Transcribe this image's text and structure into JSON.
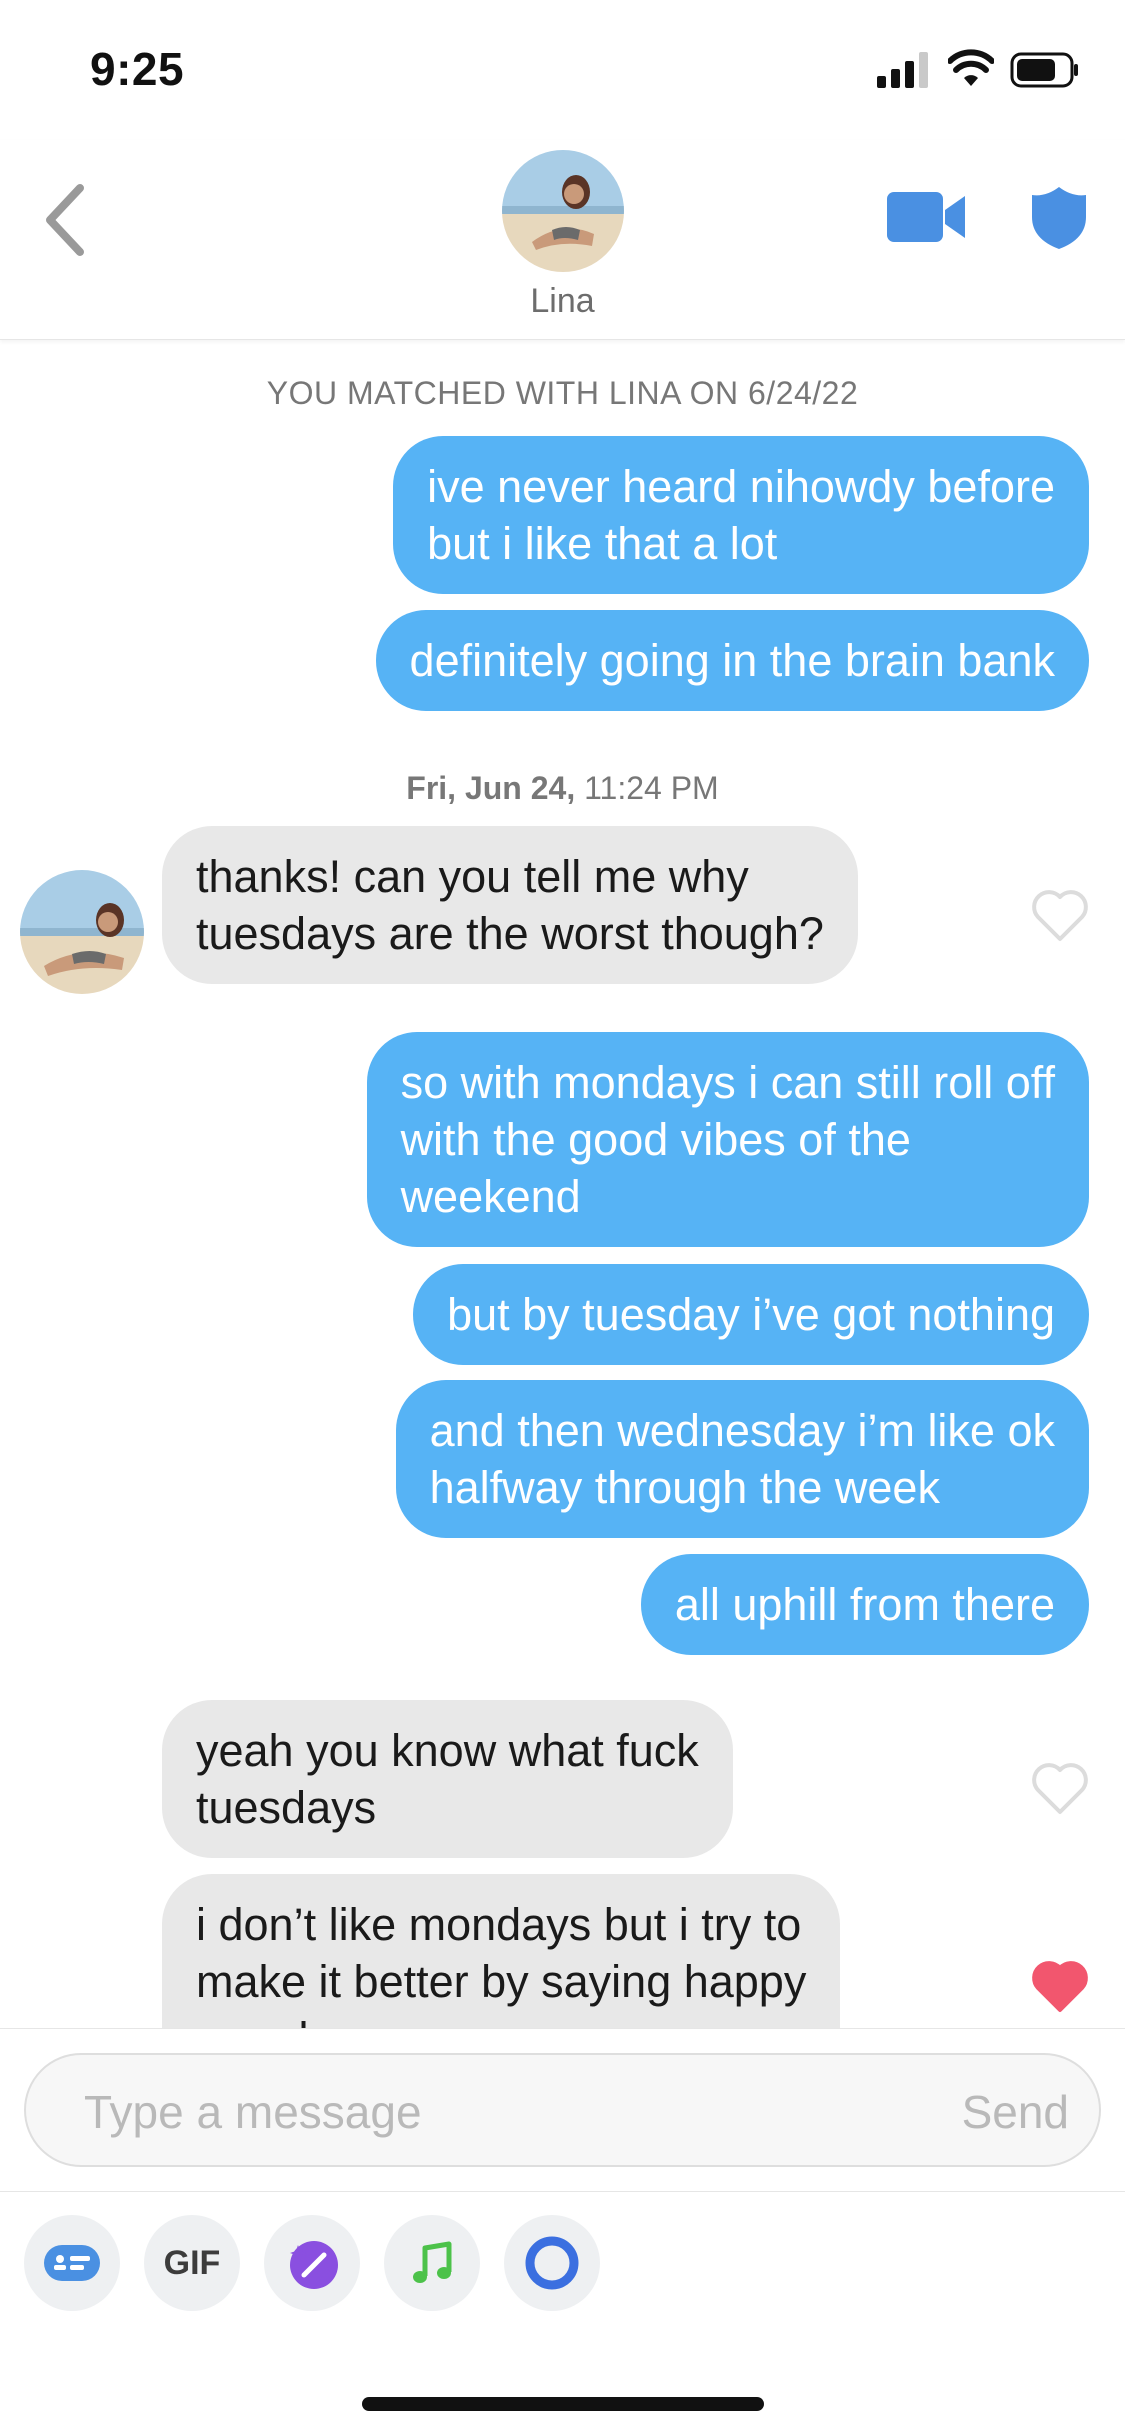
{
  "status_bar": {
    "time": "9:25"
  },
  "header": {
    "name": "Lina"
  },
  "match_note": "YOU MATCHED WITH LINA ON 6/24/22",
  "timestamp": {
    "day": "Fri, Jun 24,",
    "time": "11:24 PM"
  },
  "messages": [
    {
      "side": "outgoing",
      "text": "ive never heard nihowdy before\nbut i like that a lot"
    },
    {
      "side": "outgoing",
      "text": "definitely going in the brain bank"
    },
    {
      "side": "incoming",
      "text": "thanks! can you tell me why\ntuesdays are the worst though?",
      "liked": false
    },
    {
      "side": "outgoing",
      "text": "so with mondays i can still roll off\nwith the good vibes of the\nweekend"
    },
    {
      "side": "outgoing",
      "text": "but by tuesday i’ve got nothing"
    },
    {
      "side": "outgoing",
      "text": "and then wednesday i’m like ok\nhalfway through the week"
    },
    {
      "side": "outgoing",
      "text": "all uphill from there"
    },
    {
      "side": "incoming",
      "text": "yeah you know what fuck\ntuesdays",
      "liked": false
    },
    {
      "side": "incoming",
      "text": "i don’t like mondays but i try to\nmake it better by saying happy\nmonday",
      "liked": true
    }
  ],
  "composer": {
    "placeholder": "Type a message",
    "send_label": "Send",
    "tools": [
      {
        "icon": "sticker-card-icon"
      },
      {
        "label": "GIF",
        "icon": "gif-icon"
      },
      {
        "icon": "magic-sparkle-icon"
      },
      {
        "icon": "music-note-icon"
      },
      {
        "icon": "ring-icon"
      }
    ]
  },
  "colors": {
    "outgoing_bubble": "#56b3f5",
    "incoming_bubble": "#e8e8e8",
    "accent_blue": "#4a90e2",
    "heart_liked": "#f2566e"
  }
}
